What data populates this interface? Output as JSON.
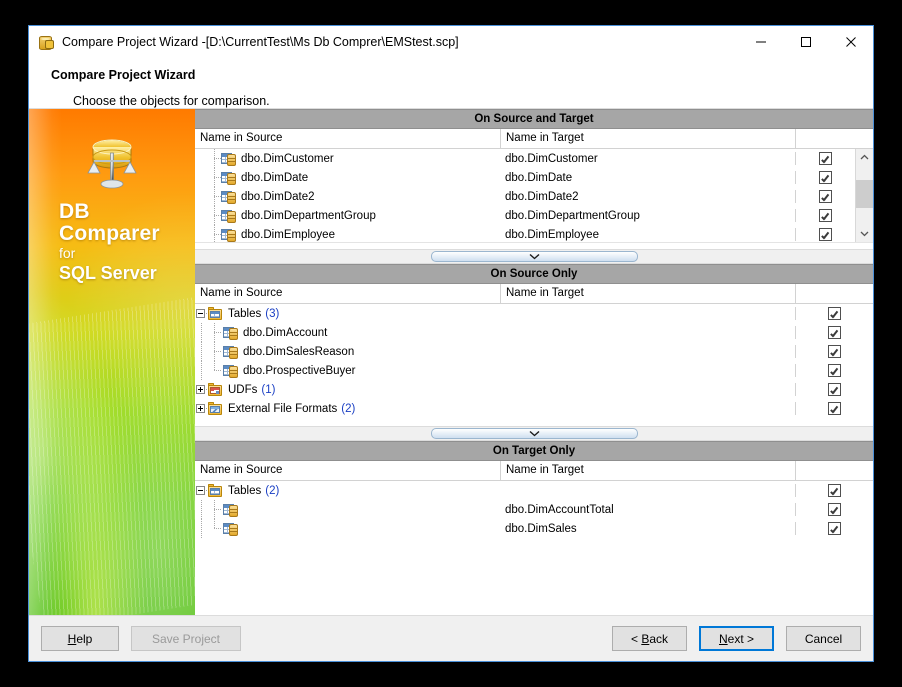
{
  "window": {
    "title": "Compare Project Wizard -[D:\\CurrentTest\\Ms Db Comprer\\EMStest.scp]",
    "minimize_label": "—",
    "maximize_label": "□",
    "close_label": "✕"
  },
  "header": {
    "title": "Compare Project Wizard",
    "subtitle": "Choose the objects for comparison."
  },
  "banner": {
    "line1": "DB",
    "line2": "Comparer",
    "line3": "for",
    "line4": "SQL Server"
  },
  "columns": {
    "source": "Name in Source",
    "target": "Name in Target"
  },
  "panes": [
    {
      "title": "On Source and Target",
      "rows": [
        {
          "source": "dbo.DimCustomer",
          "target": "dbo.DimCustomer",
          "checked": true,
          "icon": "table-icon",
          "level": 1
        },
        {
          "source": "dbo.DimDate",
          "target": "dbo.DimDate",
          "checked": true,
          "icon": "table-icon",
          "level": 1
        },
        {
          "source": "dbo.DimDate2",
          "target": "dbo.DimDate2",
          "checked": true,
          "icon": "table-icon",
          "level": 1
        },
        {
          "source": "dbo.DimDepartmentGroup",
          "target": "dbo.DimDepartmentGroup",
          "checked": true,
          "icon": "table-icon",
          "level": 1
        },
        {
          "source": "dbo.DimEmployee",
          "target": "dbo.DimEmployee",
          "checked": true,
          "icon": "table-icon",
          "level": 1
        }
      ]
    },
    {
      "title": "On Source Only",
      "rows": [
        {
          "source": "Tables",
          "count": "(3)",
          "target": "",
          "checked": true,
          "icon": "folder-tables-icon",
          "level": 0,
          "expander": "minus"
        },
        {
          "source": "dbo.DimAccount",
          "target": "",
          "checked": true,
          "icon": "table-icon",
          "level": 1,
          "highlight": true
        },
        {
          "source": "dbo.DimSalesReason",
          "target": "",
          "checked": true,
          "icon": "table-icon",
          "level": 1
        },
        {
          "source": "dbo.ProspectiveBuyer",
          "target": "",
          "checked": true,
          "icon": "table-icon",
          "level": 1
        },
        {
          "source": "UDFs",
          "count": "(1)",
          "target": "",
          "checked": true,
          "icon": "folder-udfs-icon",
          "level": 0,
          "expander": "plus"
        },
        {
          "source": "External File Formats",
          "count": "(2)",
          "target": "",
          "checked": true,
          "icon": "folder-external-icon",
          "level": 0,
          "expander": "plus"
        }
      ]
    },
    {
      "title": "On Target Only",
      "rows": [
        {
          "source": "Tables",
          "count": "(2)",
          "target": "",
          "checked": true,
          "icon": "folder-tables-icon",
          "level": 0,
          "expander": "minus"
        },
        {
          "source": "",
          "target": "dbo.DimAccountTotal",
          "checked": true,
          "icon": "table-icon",
          "level": 1
        },
        {
          "source": "",
          "target": "dbo.DimSales",
          "checked": true,
          "icon": "table-icon",
          "level": 1
        }
      ]
    }
  ],
  "footer": {
    "help": "Help",
    "save_project": "Save Project",
    "back": "< Back",
    "next": "Next >",
    "cancel": "Cancel"
  },
  "colors": {
    "accent": "#0078d7",
    "pane_header_bg": "#a6a6a6",
    "count_text": "#1a3fc4",
    "highlight_row": "#f0f0f0"
  }
}
